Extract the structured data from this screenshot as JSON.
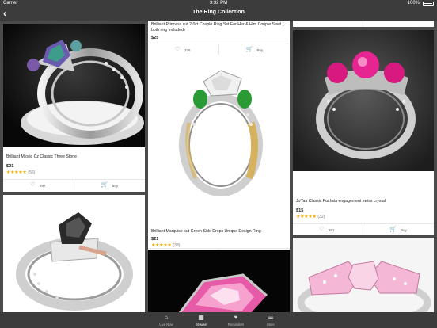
{
  "status_bar": {
    "carrier": "Carrier",
    "time": "3:32 PM",
    "battery": "100%"
  },
  "header": {
    "title": "The Ring Collection",
    "back_icon": "back-chevron-icon"
  },
  "products": [
    {
      "name": "Brilliant Mystic Cz Classic Three Stone",
      "price": "$21",
      "stars": "★★★★★",
      "reviews": "(56)",
      "likes": "267",
      "buy": "Buy"
    },
    {
      "name": "Brilliant Princess cut 2.0ct Couple Ring Set For Her & Him Couple Steel ( both ring included)",
      "price": "$25",
      "likes": "336",
      "buy": "Buy"
    },
    {
      "name": "Brilliant Marquise cut Green Side Drops Unique Design Ring",
      "price": "$21",
      "stars": "★★★★★",
      "reviews": "(38)",
      "likes": "241",
      "buy": "Buy"
    },
    {
      "name": "JoYau Classic Fuchsia engagement swiss crystal",
      "price": "$15",
      "stars": "★★★★★",
      "reviews": "(32)",
      "likes": "281",
      "buy": "Buy"
    }
  ],
  "tabs": [
    {
      "label": "Live Now",
      "icon": "house-icon"
    },
    {
      "label": "Browse",
      "icon": "grid-icon"
    },
    {
      "label": "Reminders",
      "icon": "heart-icon"
    },
    {
      "label": "More",
      "icon": "menu-icon"
    }
  ],
  "colors": {
    "bar": "#3c3c3c",
    "background": "#4a4a4a",
    "star": "#f2a900",
    "buy": "#2e9c3a"
  }
}
